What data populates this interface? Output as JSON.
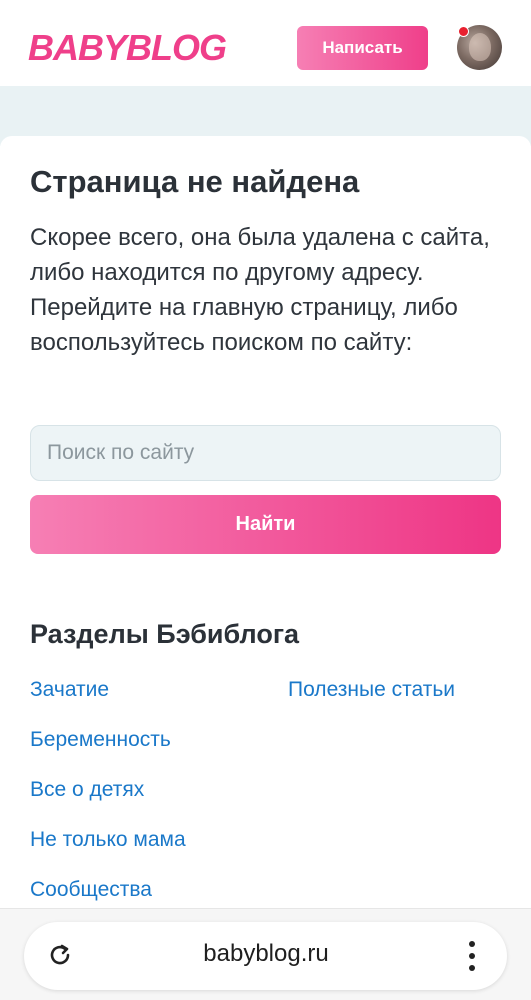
{
  "header": {
    "logo_text": "BABYBLOG",
    "write_button": "Написать"
  },
  "main": {
    "title": "Страница не найдена",
    "description": "Скорее всего, она была удалена с сайта, либо находится по другому адресу. Перейдите на главную страницу, либо воспользуйтесь поиском по сайту:",
    "search": {
      "placeholder": "Поиск по сайту",
      "value": ""
    },
    "find_button": "Найти",
    "sections_title": "Разделы Бэбиблога",
    "sections": [
      "Зачатие",
      "Полезные статьи",
      "Беременность",
      "Все о детях",
      "Не только мама",
      "Сообщества"
    ]
  },
  "browser": {
    "url": "babyblog.ru"
  },
  "colors": {
    "brand_pink": "#ef3f8a",
    "link_blue": "#1a78c9",
    "notification_red": "#e8202f"
  },
  "icons": [
    "reload-icon",
    "more-vert-icon"
  ]
}
